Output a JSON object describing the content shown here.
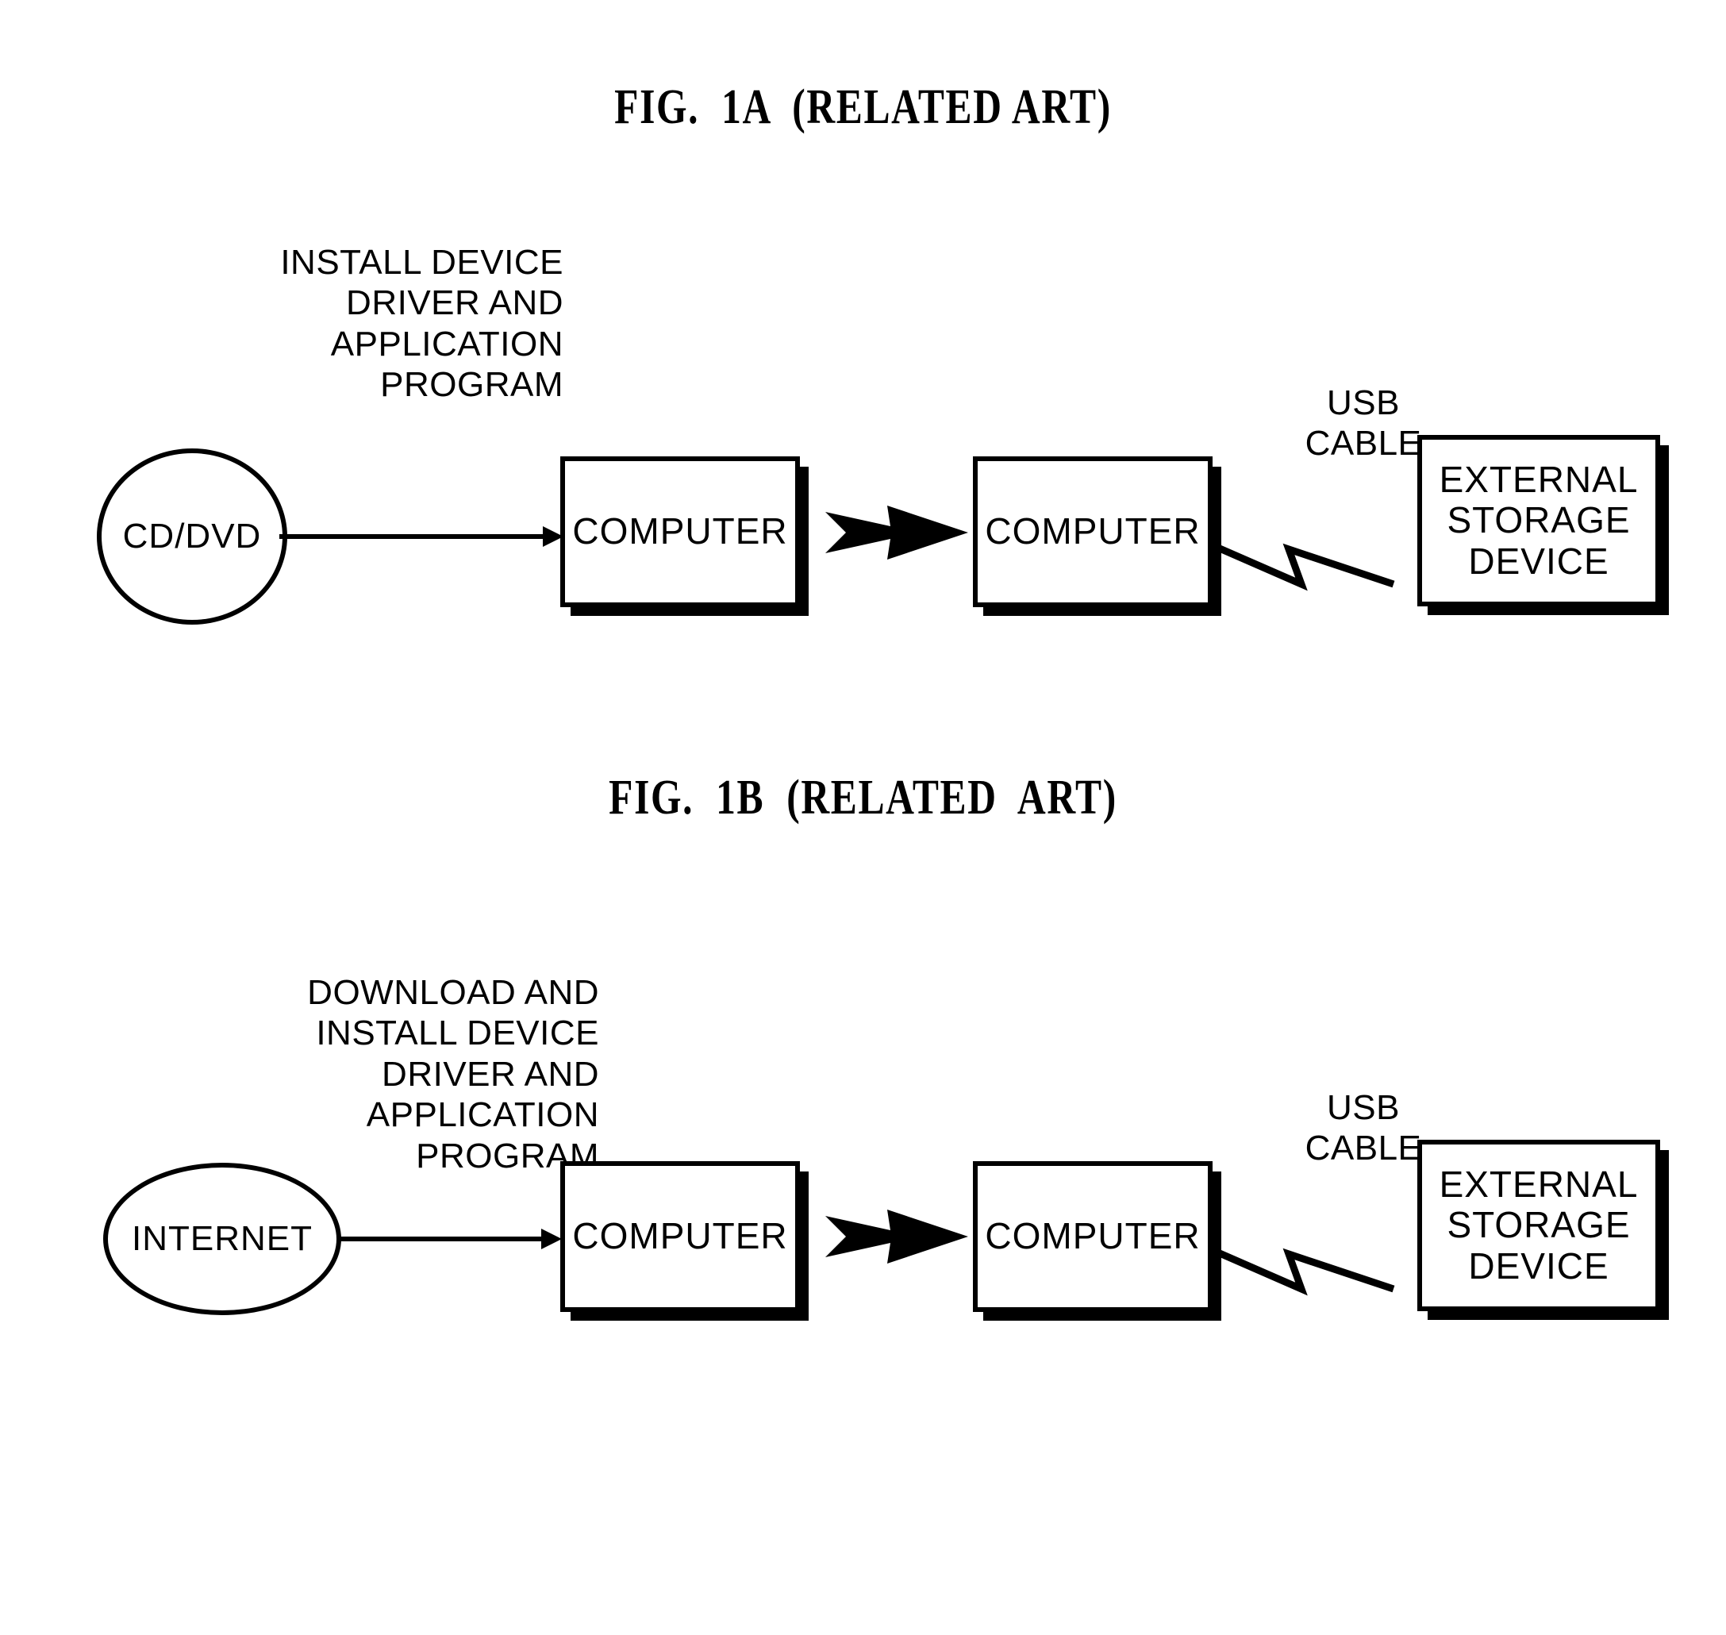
{
  "figures": [
    {
      "title": "FIG.  1A  (RELATED ART)",
      "caption": "INSTALL DEVICE\nDRIVER AND\nAPPLICATION\nPROGRAM",
      "source_label": "CD/DVD",
      "source_shape": "circle",
      "computer_left_label": "COMPUTER",
      "computer_right_label": "COMPUTER",
      "cable_label": "USB\nCABLE",
      "target_label": "EXTERNAL\nSTORAGE\nDEVICE"
    },
    {
      "title": "FIG.  1B  (RELATED  ART)",
      "caption": "DOWNLOAD AND\nINSTALL DEVICE\nDRIVER AND\nAPPLICATION\nPROGRAM",
      "source_label": "INTERNET",
      "source_shape": "ellipse",
      "computer_left_label": "COMPUTER",
      "computer_right_label": "COMPUTER",
      "cable_label": "USB\nCABLE",
      "target_label": "EXTERNAL\nSTORAGE\nDEVICE"
    }
  ],
  "colors": {
    "ink": "#000000",
    "paper": "#ffffff"
  }
}
